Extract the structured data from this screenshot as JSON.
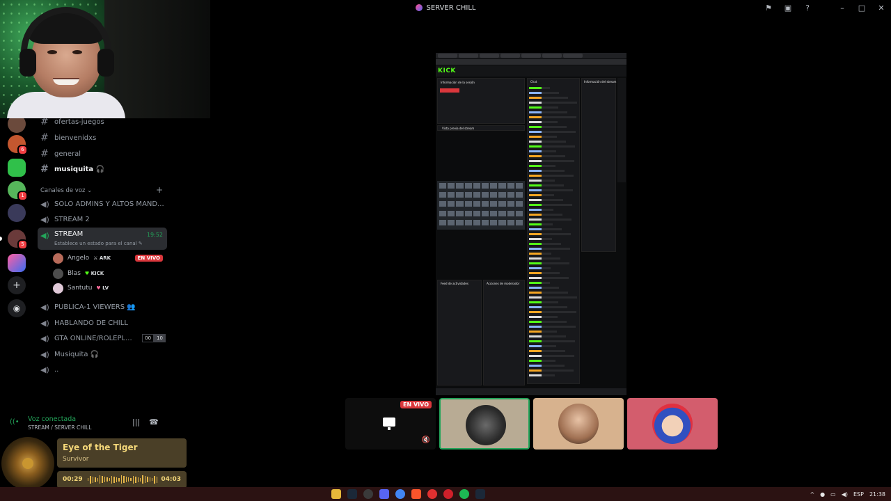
{
  "window": {
    "title": "SERVER CHILL"
  },
  "channels": {
    "text": [
      "ofertas-juegos",
      "bienvenidxs",
      "general",
      "musiquita 🎧"
    ],
    "voice_category": "Canales de voz",
    "voice": [
      {
        "name": "SOLO ADMINS Y ALTOS MAND..."
      },
      {
        "name": "STREAM 2"
      }
    ],
    "active": {
      "name": "STREAM",
      "time": "19:52",
      "status": "Establece un estado para el canal"
    },
    "users": [
      {
        "name": "Angelo",
        "tag": "ARK",
        "live": "EN VIVO",
        "color": "#b86b5a"
      },
      {
        "name": "Blas",
        "tag": "KICK",
        "color": "#4d4d4d"
      },
      {
        "name": "Santutu",
        "tag": "LV",
        "color": "#e0c9d8"
      }
    ],
    "voice_after": [
      {
        "name": "PUBLICA-1 VIEWERS 👥"
      },
      {
        "name": "HABLANDO DE CHILL"
      },
      {
        "name": "GTA ONLINE/ROLEPL...",
        "count_a": "00",
        "count_b": "10"
      },
      {
        "name": "Musiquita 🎧"
      },
      {
        "name": ".."
      }
    ]
  },
  "voice_panel": {
    "label": "Voz conectada",
    "sub": "STREAM / SERVER CHILL"
  },
  "now_playing": {
    "song": "Eye of the Tiger",
    "artist": "Survivor",
    "elapsed": "00:29",
    "total": "04:03",
    "progress": 0.12
  },
  "stream_view": {
    "brand": "KICK",
    "session_title": "Información de la sesión",
    "chat_title": "Chat",
    "stream_info": "Información del stream",
    "activity": "Feed de actividades",
    "mod_actions": "Acciones de moderador",
    "video_label": "Vista previa del stream"
  },
  "tiles": {
    "live": "EN VIVO"
  },
  "taskbar": {
    "lang": "ESP",
    "time": "21:38"
  }
}
